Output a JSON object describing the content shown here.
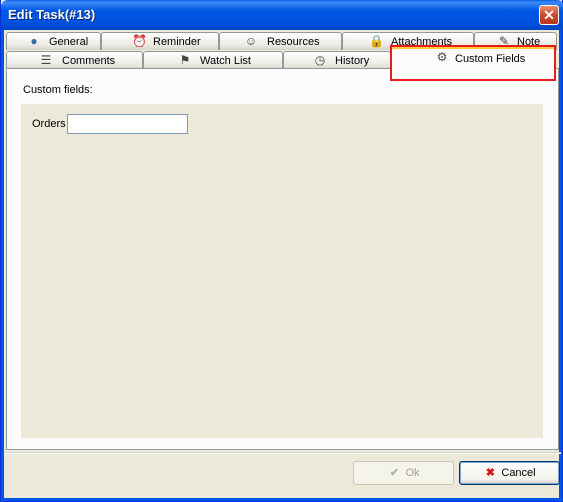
{
  "window": {
    "title": "Edit Task(#13)",
    "close_glyph": "✕"
  },
  "tabs_row1": [
    {
      "label": "General",
      "icon": "globe-icon",
      "glyph": "●"
    },
    {
      "label": "Reminder",
      "icon": "alarm-clock-icon",
      "glyph": "⏰"
    },
    {
      "label": "Resources",
      "icon": "person-icon",
      "glyph": "☺"
    },
    {
      "label": "Attachments",
      "icon": "lock-icon",
      "glyph": "🔒"
    },
    {
      "label": "Note",
      "icon": "note-icon",
      "glyph": "✎"
    }
  ],
  "tabs_row2": [
    {
      "label": "Comments",
      "icon": "comments-icon",
      "glyph": "☰"
    },
    {
      "label": "Watch List",
      "icon": "watch-list-icon",
      "glyph": "⚑"
    },
    {
      "label": "History",
      "icon": "history-icon",
      "glyph": "◷"
    },
    {
      "label": "Custom Fields",
      "icon": "gear-icon",
      "glyph": "⚙",
      "active": true
    }
  ],
  "panel": {
    "label": "Custom fields:",
    "fields": [
      {
        "label": "Orders",
        "value": ""
      }
    ]
  },
  "buttons": {
    "ok": {
      "label": "Ok",
      "glyph": "✔",
      "disabled": true
    },
    "cancel": {
      "label": "Cancel",
      "glyph": "✖"
    }
  },
  "colors": {
    "titlebar": "#0054e3",
    "highlight": "#e81c1c",
    "panel_bg": "#ece9d8",
    "cancel_icon": "#d01c1c"
  }
}
